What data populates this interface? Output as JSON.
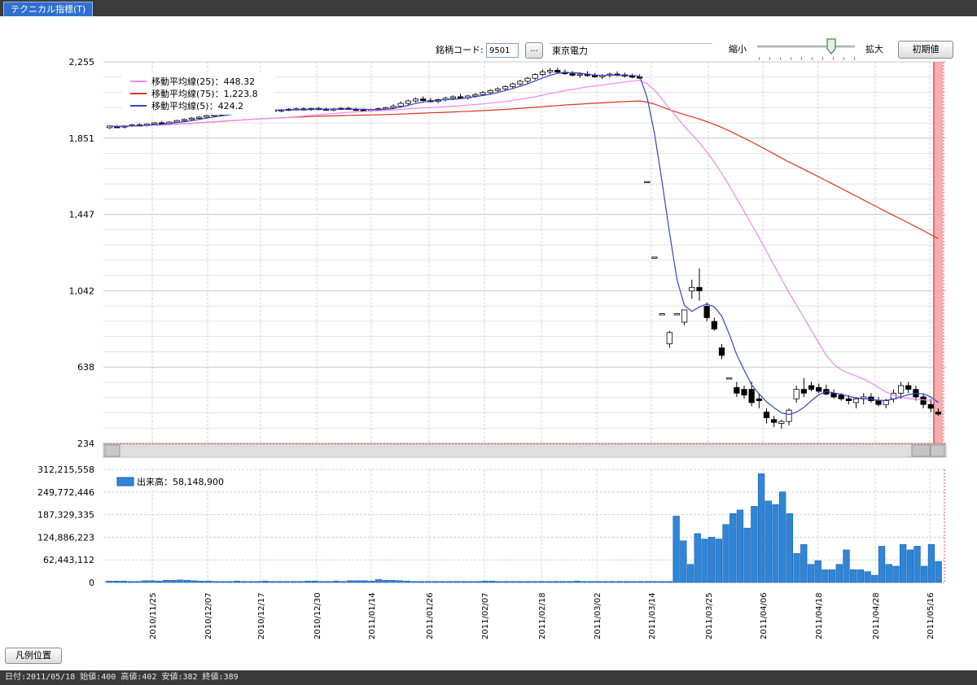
{
  "window": {
    "tab_title": "テクニカル指標(T)"
  },
  "toolbar": {
    "code_label": "銘柄コード:",
    "code_value": "9501",
    "browse_label": "...",
    "company_name": "東京電力",
    "zoom_out_label": "縮小",
    "zoom_in_label": "拡大",
    "reset_label": "初期値"
  },
  "legend_position_button": "凡例位置",
  "status": "日付:2011/05/18 始値:400 高値:402 安値:382 終値:389",
  "colors": {
    "ma25": "#ee88ee",
    "ma75": "#dd3322",
    "ma5": "#3344cc",
    "volume": "#2f86d8",
    "highlight": "#f4a0a0"
  },
  "chart_data": [
    {
      "type": "candlestick",
      "ylim": [
        234,
        2255
      ],
      "y_ticks": [
        "2,255",
        "1,851",
        "1,447",
        "1,042",
        "638",
        "234"
      ],
      "legend": [
        {
          "label": "移動平均線(25)：448.32",
          "color": "#ee88ee"
        },
        {
          "label": "移動平均線(75)：1,223.8",
          "color": "#dd3322"
        },
        {
          "label": "移動平均線(5)：424.2",
          "color": "#3344cc"
        }
      ],
      "x_tick_labels": [
        "2010/11/25",
        "2010/12/07",
        "2010/12/17",
        "2010/12/30",
        "2011/01/14",
        "2011/01/26",
        "2011/02/07",
        "2011/02/18",
        "2011/03/02",
        "2011/03/14",
        "2011/03/25",
        "2011/04/06",
        "2011/04/18",
        "2011/04/28",
        "2011/05/16"
      ],
      "candles": [
        [
          1906,
          1919,
          1900,
          1915
        ],
        [
          1912,
          1920,
          1906,
          1910
        ],
        [
          1910,
          1918,
          1902,
          1916
        ],
        [
          1916,
          1926,
          1910,
          1921
        ],
        [
          1921,
          1930,
          1915,
          1918
        ],
        [
          1918,
          1928,
          1912,
          1925
        ],
        [
          1925,
          1936,
          1920,
          1932
        ],
        [
          1932,
          1942,
          1926,
          1928
        ],
        [
          1928,
          1940,
          1924,
          1936
        ],
        [
          1936,
          1948,
          1930,
          1944
        ],
        [
          1944,
          1955,
          1938,
          1950
        ],
        [
          1950,
          1962,
          1945,
          1957
        ],
        [
          1957,
          1968,
          1950,
          1962
        ],
        [
          1962,
          1975,
          1955,
          1970
        ],
        [
          1970,
          1983,
          1964,
          1975
        ],
        [
          1975,
          1988,
          1968,
          1980
        ],
        [
          1980,
          1992,
          1972,
          1985
        ],
        [
          1985,
          1998,
          1978,
          1990
        ],
        [
          1990,
          2002,
          1984,
          1996
        ],
        [
          1996,
          2008,
          1990,
          1999
        ],
        [
          1999,
          2010,
          1992,
          2002
        ],
        [
          2002,
          2012,
          1995,
          2000
        ],
        [
          2000,
          2008,
          1990,
          1995
        ],
        [
          1995,
          2004,
          1988,
          2001
        ],
        [
          2001,
          2010,
          1994,
          2004
        ],
        [
          2004,
          2013,
          1998,
          2006
        ],
        [
          2006,
          2014,
          2000,
          2003
        ],
        [
          2003,
          2011,
          1996,
          2008
        ],
        [
          2008,
          2016,
          2000,
          2005
        ],
        [
          2005,
          2012,
          1998,
          2001
        ],
        [
          2001,
          2010,
          1994,
          2006
        ],
        [
          2006,
          2015,
          2000,
          2009
        ],
        [
          2009,
          2016,
          2002,
          2004
        ],
        [
          2004,
          2012,
          1996,
          2000
        ],
        [
          2000,
          2008,
          1992,
          1997
        ],
        [
          1997,
          2006,
          1990,
          2002
        ],
        [
          2002,
          2012,
          1996,
          2007
        ],
        [
          2007,
          2018,
          2000,
          2012
        ],
        [
          2012,
          2030,
          2004,
          2020
        ],
        [
          2020,
          2045,
          2012,
          2035
        ],
        [
          2035,
          2055,
          2026,
          2048
        ],
        [
          2048,
          2066,
          2040,
          2058
        ],
        [
          2058,
          2072,
          2045,
          2050
        ],
        [
          2050,
          2064,
          2040,
          2045
        ],
        [
          2045,
          2060,
          2036,
          2055
        ],
        [
          2055,
          2070,
          2046,
          2062
        ],
        [
          2062,
          2078,
          2052,
          2070
        ],
        [
          2070,
          2085,
          2060,
          2064
        ],
        [
          2064,
          2080,
          2055,
          2074
        ],
        [
          2074,
          2090,
          2066,
          2082
        ],
        [
          2082,
          2100,
          2075,
          2092
        ],
        [
          2092,
          2110,
          2084,
          2103
        ],
        [
          2103,
          2120,
          2094,
          2112
        ],
        [
          2112,
          2130,
          2104,
          2124
        ],
        [
          2124,
          2145,
          2116,
          2138
        ],
        [
          2138,
          2160,
          2130,
          2152
        ],
        [
          2152,
          2175,
          2140,
          2168
        ],
        [
          2168,
          2195,
          2160,
          2188
        ],
        [
          2188,
          2215,
          2180,
          2202
        ],
        [
          2202,
          2222,
          2190,
          2210
        ],
        [
          2210,
          2224,
          2196,
          2200
        ],
        [
          2200,
          2214,
          2186,
          2192
        ],
        [
          2192,
          2206,
          2178,
          2184
        ],
        [
          2184,
          2200,
          2170,
          2190
        ],
        [
          2190,
          2205,
          2176,
          2182
        ],
        [
          2182,
          2196,
          2170,
          2176
        ],
        [
          2176,
          2190,
          2164,
          2183
        ],
        [
          2183,
          2198,
          2172,
          2190
        ],
        [
          2190,
          2204,
          2178,
          2186
        ],
        [
          2186,
          2198,
          2172,
          2180
        ],
        [
          2180,
          2192,
          2168,
          2175
        ],
        [
          2175,
          2188,
          2164,
          2170
        ],
        [
          1621,
          1621,
          1621,
          1621
        ],
        [
          1221,
          1221,
          1221,
          1221
        ],
        [
          921,
          921,
          921,
          921
        ],
        [
          761,
          830,
          740,
          821
        ],
        [
          921,
          921,
          921,
          921
        ],
        [
          876,
          942,
          860,
          941
        ],
        [
          1041,
          1101,
          1000,
          1060
        ],
        [
          1060,
          1161,
          990,
          1042
        ],
        [
          960,
          980,
          880,
          900
        ],
        [
          880,
          900,
          830,
          840
        ],
        [
          740,
          760,
          680,
          700
        ],
        [
          581,
          581,
          581,
          581
        ],
        [
          530,
          560,
          480,
          500
        ],
        [
          520,
          540,
          470,
          490
        ],
        [
          520,
          560,
          430,
          450
        ],
        [
          470,
          500,
          420,
          460
        ],
        [
          400,
          420,
          340,
          370
        ],
        [
          360,
          380,
          320,
          345
        ],
        [
          340,
          360,
          312,
          350
        ],
        [
          350,
          420,
          330,
          410
        ],
        [
          470,
          540,
          450,
          520
        ],
        [
          520,
          580,
          480,
          500
        ],
        [
          540,
          560,
          510,
          520
        ],
        [
          530,
          550,
          500,
          510
        ],
        [
          520,
          545,
          490,
          495
        ],
        [
          500,
          520,
          470,
          480
        ],
        [
          490,
          500,
          460,
          470
        ],
        [
          470,
          490,
          440,
          460
        ],
        [
          450,
          480,
          420,
          470
        ],
        [
          470,
          500,
          440,
          480
        ],
        [
          480,
          500,
          450,
          460
        ],
        [
          460,
          480,
          430,
          440
        ],
        [
          440,
          470,
          420,
          460
        ],
        [
          470,
          520,
          450,
          500
        ],
        [
          500,
          560,
          470,
          540
        ],
        [
          540,
          560,
          500,
          520
        ],
        [
          520,
          540,
          460,
          480
        ],
        [
          480,
          500,
          420,
          440
        ],
        [
          440,
          470,
          400,
          420
        ],
        [
          400,
          420,
          380,
          389
        ]
      ]
    },
    {
      "type": "bar",
      "ylim": [
        0,
        312215558
      ],
      "y_ticks": [
        "312,215,558",
        "249,772,446",
        "187,329,335",
        "124,886,223",
        "62,443,112",
        "0"
      ],
      "legend": [
        {
          "label": "出来高：58,148,900",
          "color": "#2f86d8"
        }
      ],
      "values": [
        4,
        4,
        4,
        3,
        3,
        5,
        5,
        4,
        6,
        6,
        7,
        6,
        5,
        4,
        4,
        3,
        3,
        3,
        4,
        3,
        3,
        3,
        4,
        3,
        3,
        3,
        3,
        3,
        4,
        4,
        3,
        3,
        4,
        3,
        5,
        5,
        5,
        4,
        8,
        6,
        6,
        5,
        4,
        3,
        3,
        3,
        3,
        3,
        3,
        3,
        3,
        3,
        3,
        4,
        4,
        3,
        3,
        3,
        3,
        3,
        3,
        3,
        3,
        3,
        3,
        3,
        4,
        3,
        3,
        3,
        3,
        3,
        3,
        3,
        3,
        3,
        3,
        3,
        3,
        3,
        183,
        115,
        50,
        135,
        120,
        125,
        120,
        160,
        190,
        200,
        150,
        210,
        300,
        225,
        215,
        250,
        190,
        80,
        105,
        50,
        60,
        35,
        35,
        50,
        90,
        35,
        35,
        30,
        20,
        100,
        50,
        45,
        105,
        90,
        100,
        45,
        105,
        58
      ]
    }
  ]
}
